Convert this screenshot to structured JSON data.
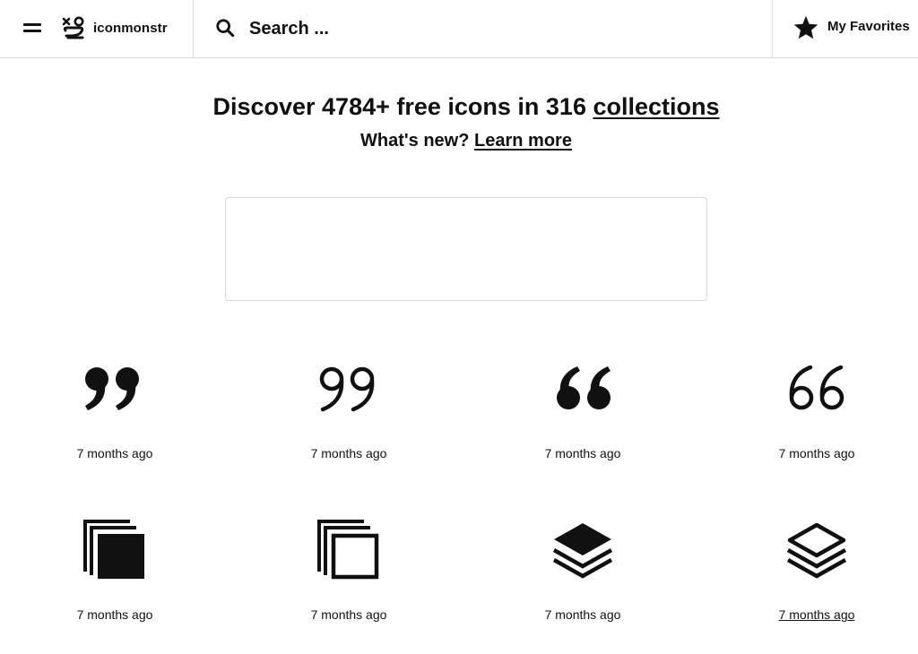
{
  "header": {
    "logo_text": "iconmonstr",
    "search_placeholder": "Search ...",
    "favorites_label": "My Favorites"
  },
  "hero": {
    "title_prefix": "Discover 4784+ free icons in 316 ",
    "title_link": "collections",
    "subtitle_prefix": "What's new? ",
    "subtitle_link": "Learn more"
  },
  "icons": [
    {
      "name": "quote-close-filled",
      "date": "7 months ago"
    },
    {
      "name": "quote-close-outline",
      "date": "7 months ago"
    },
    {
      "name": "quote-open-filled",
      "date": "7 months ago"
    },
    {
      "name": "quote-open-outline",
      "date": "7 months ago"
    },
    {
      "name": "copy-filled",
      "date": "7 months ago"
    },
    {
      "name": "copy-outline",
      "date": "7 months ago"
    },
    {
      "name": "layers-filled",
      "date": "7 months ago"
    },
    {
      "name": "layers-outline",
      "date": "7 months ago"
    }
  ],
  "colors": {
    "text": "#111111",
    "border": "#dcdcdc",
    "background": "#ffffff"
  }
}
